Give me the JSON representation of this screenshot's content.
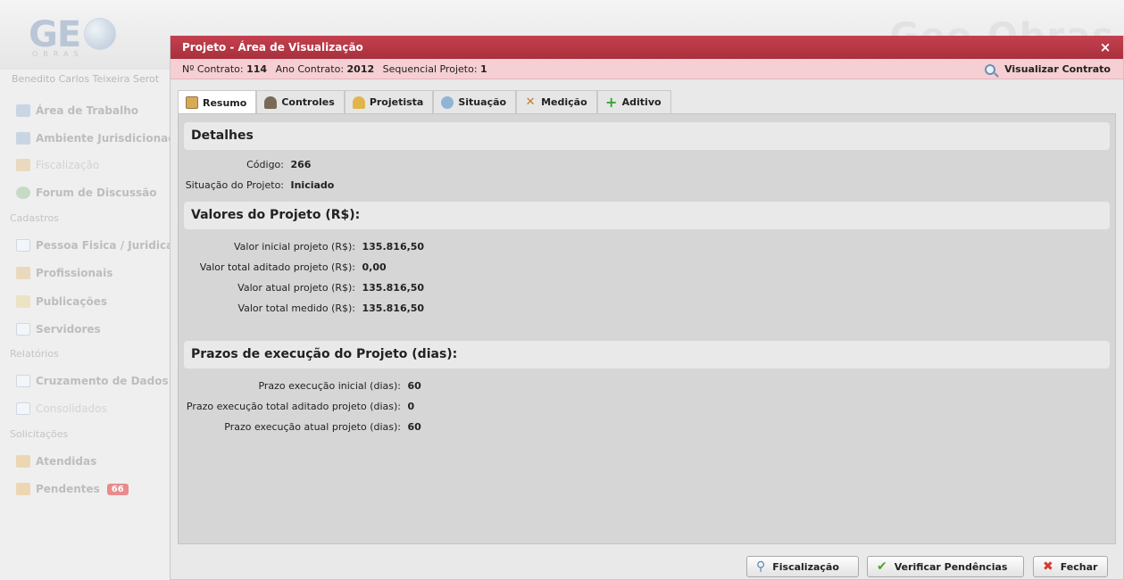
{
  "app": {
    "logo_text": "GE",
    "logo_sub": "OBRAS",
    "bg_brand": "Geo Obras",
    "user_name": "Benedito Carlos Teixeira Serot",
    "sidebar": {
      "items_top": [
        {
          "label": "Área de Trabalho",
          "icon": "users-icon"
        },
        {
          "label": "Ambiente Jurisdicionad",
          "icon": "users-icon"
        },
        {
          "label": "Fiscalização",
          "icon": "inspector-icon"
        },
        {
          "label": "Forum de Discussão",
          "icon": "forum-icon"
        }
      ],
      "section_cadastros": "Cadastros",
      "items_cadastros": [
        {
          "label": "Pessoa Fisica / Juridica",
          "icon": "window-icon"
        },
        {
          "label": "Profissionais",
          "icon": "person-icon"
        },
        {
          "label": "Publicações",
          "icon": "folder-icon"
        },
        {
          "label": "Servidores",
          "icon": "window-icon"
        }
      ],
      "section_relatorios": "Relatórios",
      "items_relatorios": [
        {
          "label": "Cruzamento de Dados",
          "icon": "window-icon"
        },
        {
          "label": "Consolidados",
          "icon": "window-icon"
        }
      ],
      "section_solicitacoes": "Solicitações",
      "items_solicitacoes": [
        {
          "label": "Atendidas",
          "icon": "inbox-icon"
        },
        {
          "label": "Pendentes",
          "icon": "inbox-icon",
          "badge": "66"
        }
      ]
    }
  },
  "dialog": {
    "title": "Projeto - Área de Visualização",
    "close": "×",
    "info": {
      "contrato_label": "Nº Contrato:",
      "contrato_value": "114",
      "ano_label": "Ano Contrato:",
      "ano_value": "2012",
      "seq_label": "Sequencial Projeto:",
      "seq_value": "1",
      "view_contract": "Visualizar Contrato"
    },
    "tabs": [
      {
        "label": "Resumo",
        "active": true
      },
      {
        "label": "Controles"
      },
      {
        "label": "Projetista"
      },
      {
        "label": "Situação"
      },
      {
        "label": "Medição"
      },
      {
        "label": "Aditivo"
      }
    ],
    "detalhes": {
      "title": "Detalhes",
      "codigo_label": "Código:",
      "codigo_value": "266",
      "situacao_label": "Situação do Projeto:",
      "situacao_value": "Iniciado"
    },
    "valores": {
      "title": "Valores do Projeto (R$):",
      "rows": [
        {
          "label": "Valor inicial projeto (R$):",
          "value": "135.816,50"
        },
        {
          "label": "Valor total aditado projeto (R$):",
          "value": "0,00"
        },
        {
          "label": "Valor atual projeto (R$):",
          "value": "135.816,50"
        },
        {
          "label": "Valor total medido (R$):",
          "value": "135.816,50"
        }
      ]
    },
    "prazos": {
      "title": "Prazos de execução do Projeto (dias):",
      "rows": [
        {
          "label": "Prazo execução inicial (dias):",
          "value": "60"
        },
        {
          "label": "Prazo execução total aditado projeto (dias):",
          "value": "0"
        },
        {
          "label": "Prazo execução atual projeto (dias):",
          "value": "60"
        }
      ]
    },
    "buttons": {
      "fiscalizacao": "Fiscalização",
      "verificar": "Verificar Pendências",
      "fechar": "Fechar"
    }
  }
}
